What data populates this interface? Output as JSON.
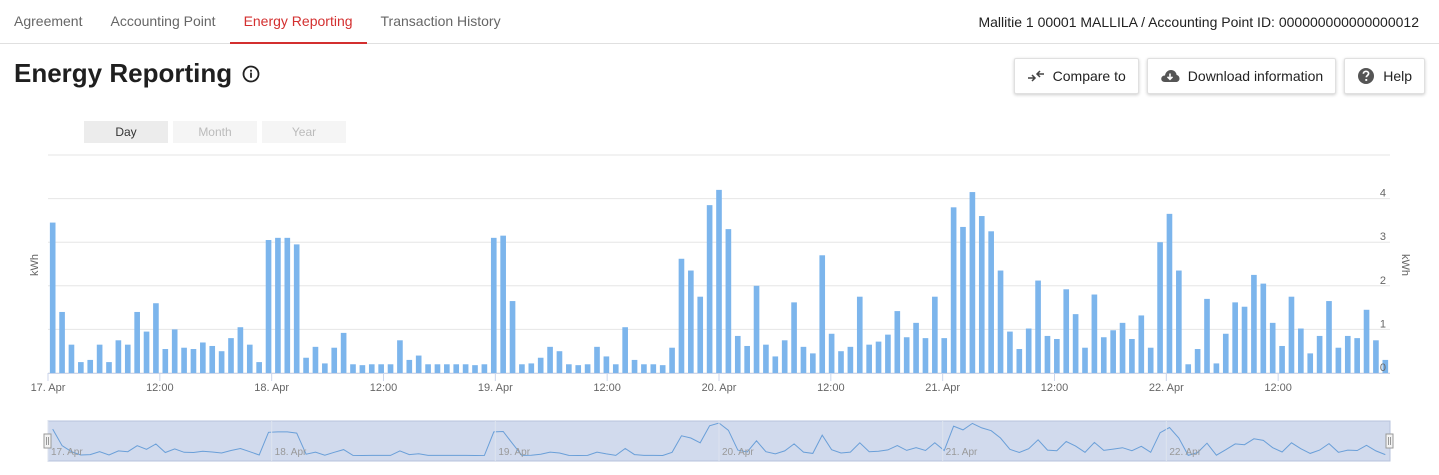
{
  "tabs": [
    {
      "label": "Agreement",
      "active": false
    },
    {
      "label": "Accounting Point",
      "active": false
    },
    {
      "label": "Energy Reporting",
      "active": true
    },
    {
      "label": "Transaction History",
      "active": false
    }
  ],
  "breadcrumb": "Mallitie 1 00001 MALLILA / Accounting Point ID: 000000000000000012",
  "page_title": "Energy Reporting",
  "actions": {
    "compare_label": "Compare to",
    "download_label": "Download information",
    "help_label": "Help"
  },
  "range_tabs": [
    {
      "label": "Day",
      "active": true
    },
    {
      "label": "Month",
      "active": false
    },
    {
      "label": "Year",
      "active": false
    }
  ],
  "colors": {
    "accent": "#d32f2f",
    "bar": "#7cb5ec",
    "navigator_fill": "#ccd6eb"
  },
  "chart_data": {
    "type": "bar",
    "ylabel_left": "kWh",
    "ylabel_right": "kWh",
    "ylim": [
      0,
      5
    ],
    "yticks": [
      0,
      1,
      2,
      3,
      4
    ],
    "xlim_hours": [
      0,
      144
    ],
    "x_ticks": [
      {
        "h": 0,
        "label": "17. Apr"
      },
      {
        "h": 12,
        "label": "12:00"
      },
      {
        "h": 24,
        "label": "18. Apr"
      },
      {
        "h": 36,
        "label": "12:00"
      },
      {
        "h": 48,
        "label": "19. Apr"
      },
      {
        "h": 60,
        "label": "12:00"
      },
      {
        "h": 72,
        "label": "20. Apr"
      },
      {
        "h": 84,
        "label": "12:00"
      },
      {
        "h": 96,
        "label": "21. Apr"
      },
      {
        "h": 108,
        "label": "12:00"
      },
      {
        "h": 120,
        "label": "22. Apr"
      },
      {
        "h": 132,
        "label": "12:00"
      }
    ],
    "navigator_labels": [
      {
        "h": 0,
        "label": "17. Apr"
      },
      {
        "h": 24,
        "label": "18. Apr"
      },
      {
        "h": 48,
        "label": "19. Apr"
      },
      {
        "h": 72,
        "label": "20. Apr"
      },
      {
        "h": 96,
        "label": "21. Apr"
      },
      {
        "h": 120,
        "label": "22. Apr"
      }
    ],
    "values": [
      3.45,
      1.4,
      0.65,
      0.25,
      0.3,
      0.65,
      0.25,
      0.75,
      0.65,
      1.4,
      0.95,
      1.6,
      0.55,
      1.0,
      0.58,
      0.55,
      0.7,
      0.62,
      0.5,
      0.8,
      1.05,
      0.65,
      0.25,
      3.05,
      3.1,
      3.1,
      2.95,
      0.35,
      0.6,
      0.22,
      0.58,
      0.92,
      0.2,
      0.18,
      0.2,
      0.2,
      0.2,
      0.75,
      0.3,
      0.4,
      0.2,
      0.2,
      0.2,
      0.2,
      0.2,
      0.18,
      0.2,
      3.1,
      3.15,
      1.65,
      0.2,
      0.22,
      0.35,
      0.6,
      0.5,
      0.2,
      0.18,
      0.2,
      0.6,
      0.38,
      0.2,
      1.05,
      0.3,
      0.2,
      0.2,
      0.18,
      0.58,
      2.62,
      2.35,
      1.75,
      3.85,
      4.2,
      3.3,
      0.85,
      0.62,
      2.0,
      0.65,
      0.38,
      0.75,
      1.62,
      0.6,
      0.45,
      2.7,
      0.9,
      0.5,
      0.6,
      1.75,
      0.65,
      0.72,
      0.88,
      1.42,
      0.82,
      1.15,
      0.8,
      1.75,
      0.8,
      3.8,
      3.35,
      4.15,
      3.6,
      3.25,
      2.35,
      0.95,
      0.55,
      1.02,
      2.12,
      0.85,
      0.78,
      1.92,
      1.35,
      0.58,
      1.8,
      0.82,
      0.98,
      1.15,
      0.78,
      1.32,
      0.58,
      3.0,
      3.65,
      2.35,
      0.2,
      0.55,
      1.7,
      0.22,
      0.9,
      1.62,
      1.52,
      2.25,
      2.05,
      1.15,
      0.62,
      1.75,
      1.02,
      0.45,
      0.85,
      1.65,
      0.58,
      0.85,
      0.8,
      1.45,
      0.75,
      0.3
    ]
  }
}
